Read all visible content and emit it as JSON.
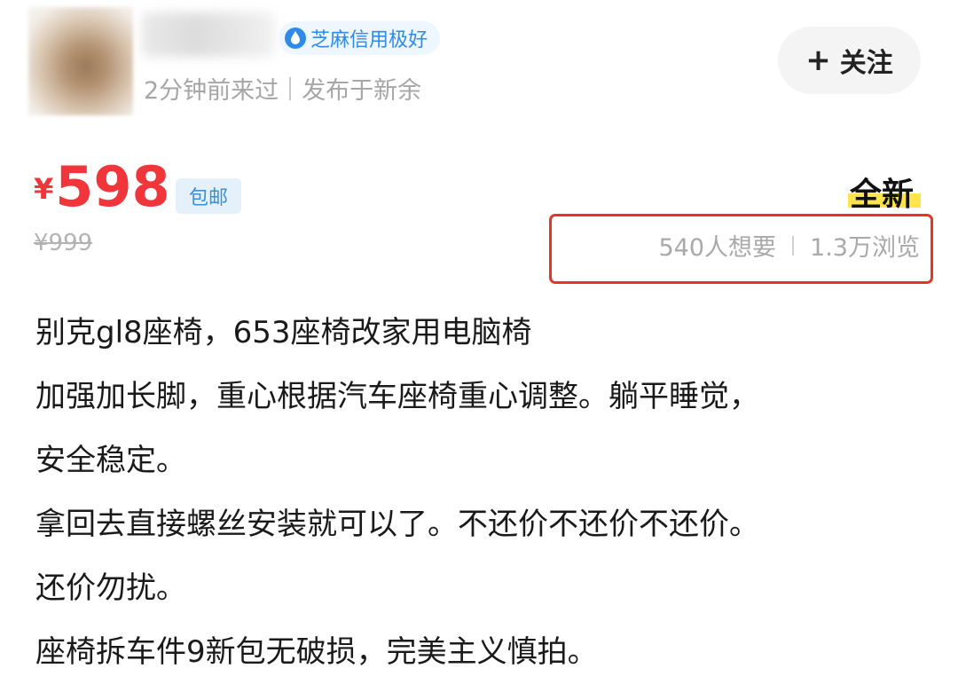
{
  "seller": {
    "credit_badge": "芝麻信用极好",
    "last_seen": "2分钟前来过",
    "location": "发布于新余"
  },
  "follow_button": {
    "label": "关注"
  },
  "listing": {
    "currency": "¥",
    "price": "598",
    "shipping_tag": "包邮",
    "original_price": "¥999",
    "condition": "全新",
    "wants": "540人想要",
    "views": "1.3万浏览"
  },
  "description": [
    "别克gl8座椅，653座椅改家用电脑椅",
    "加强加长脚，重心根据汽车座椅重心调整。躺平睡觉，",
    "安全稳定。",
    "拿回去直接螺丝安装就可以了。不还价不还价不还价。",
    "还价勿扰。",
    "座椅拆车件9新包无破损，完美主义慎拍。"
  ],
  "colors": {
    "price_red": "#f0353b",
    "badge_blue": "#2f8ae8",
    "highlight_yellow": "#ffe44d",
    "annotation_red": "#ea3323"
  }
}
